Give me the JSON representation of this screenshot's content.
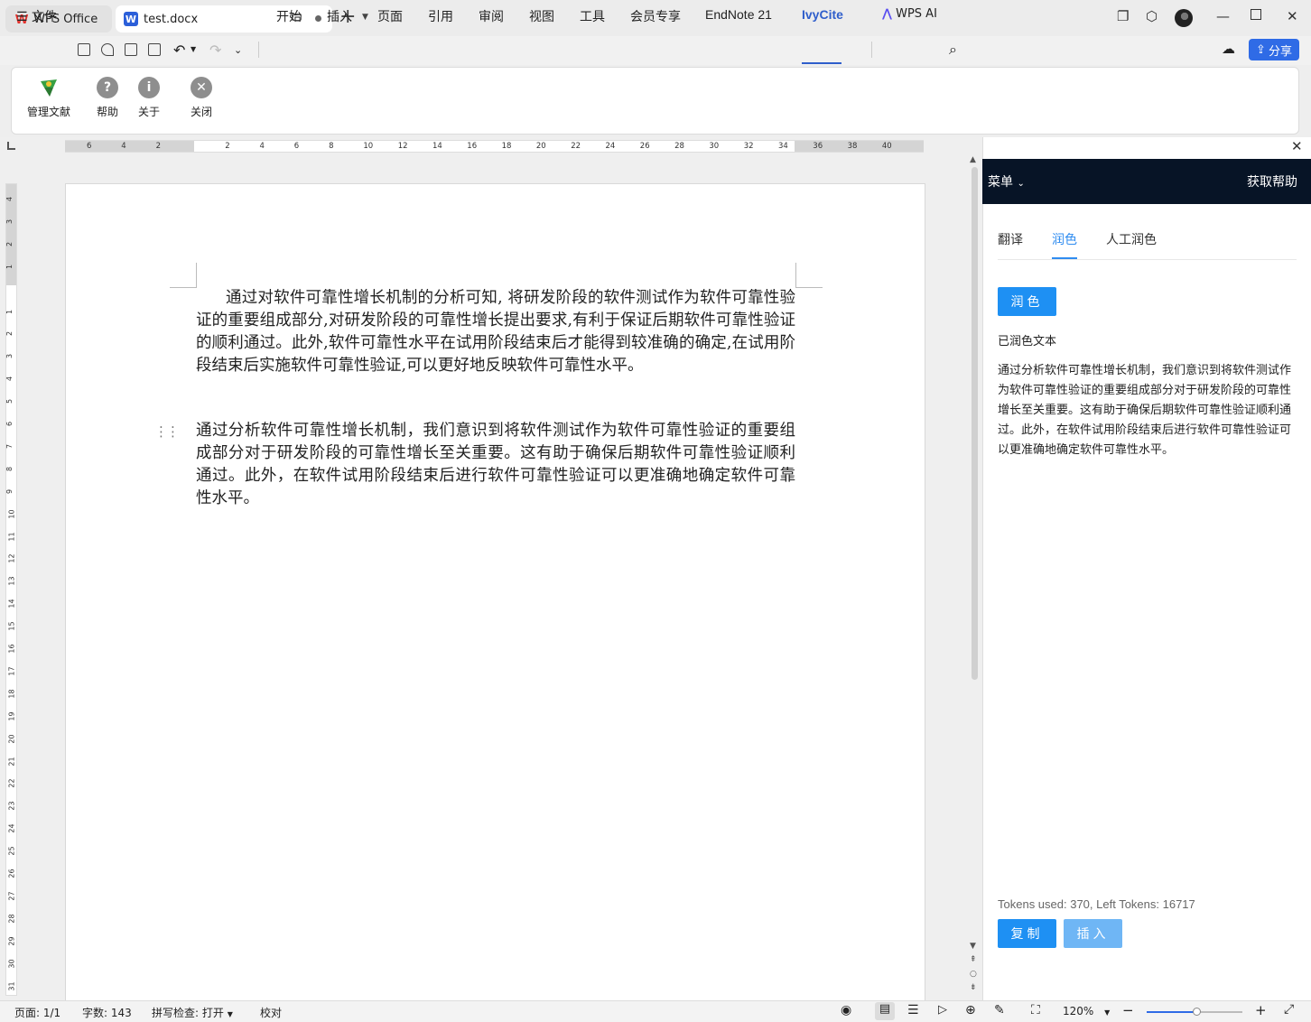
{
  "titlebar": {
    "app_tab": "WPS Office",
    "doc_tab": "test.docx"
  },
  "menubar": {
    "file": "文件",
    "items": [
      "开始",
      "插入",
      "页面",
      "引用",
      "审阅",
      "视图",
      "工具",
      "会员专享",
      "EndNote 21",
      "IvyCite"
    ],
    "active": "IvyCite",
    "wps_ai": "WPS AI",
    "share": "分享"
  },
  "ribbon": {
    "manage": "管理文献",
    "help": "帮助",
    "about": "关于",
    "close": "关闭"
  },
  "ruler": {
    "h_ticks": [
      "6",
      "4",
      "2",
      "2",
      "4",
      "6",
      "8",
      "10",
      "12",
      "14",
      "16",
      "18",
      "20",
      "22",
      "24",
      "26",
      "28",
      "30",
      "32",
      "34",
      "36",
      "38",
      "40"
    ],
    "v_ticks": [
      "4",
      "3",
      "2",
      "1",
      "1",
      "2",
      "3",
      "4",
      "5",
      "6",
      "7",
      "8",
      "9",
      "10",
      "11",
      "12",
      "13",
      "14",
      "15",
      "16",
      "17",
      "18",
      "19",
      "20",
      "21",
      "22",
      "23",
      "24",
      "25",
      "26",
      "27",
      "28",
      "29",
      "30",
      "31"
    ]
  },
  "document": {
    "para1": "通过对软件可靠性增长机制的分析可知, 将研发阶段的软件测试作为软件可靠性验证的重要组成部分,对研发阶段的可靠性增长提出要求,有利于保证后期软件可靠性验证的顺利通过。此外,软件可靠性水平在试用阶段结束后才能得到较准确的确定,在试用阶段结束后实施软件可靠性验证,可以更好地反映软件可靠性水平。",
    "para2": "通过分析软件可靠性增长机制，我们意识到将软件测试作为软件可靠性验证的重要组成部分对于研发阶段的可靠性增长至关重要。这有助于确保后期软件可靠性验证顺利通过。此外，在软件试用阶段结束后进行软件可靠性验证可以更准确地确定软件可靠性水平。"
  },
  "panel": {
    "menu": "菜单",
    "get_help": "获取帮助",
    "tabs": [
      "翻译",
      "润色",
      "人工润色"
    ],
    "active_tab": "润色",
    "polish_button": "润色",
    "polished_label": "已润色文本",
    "polished_text": "通过分析软件可靠性增长机制，我们意识到将软件测试作为软件可靠性验证的重要组成部分对于研发阶段的可靠性增长至关重要。这有助于确保后期软件可靠性验证顺利通过。此外，在软件试用阶段结束后进行软件可靠性验证可以更准确地确定软件可靠性水平。",
    "tokens": "Tokens used: 370, Left Tokens: 16717",
    "copy_button": "复制",
    "insert_button": "插入"
  },
  "statusbar": {
    "page": "页面: 1/1",
    "words": "字数: 143",
    "spell": "拼写检查: 打开",
    "proof": "校对",
    "zoom": "120%",
    "zoom_fraction": 0.52
  },
  "colors": {
    "accent": "#2f5ecb",
    "panel_header": "#071426",
    "panel_button": "#1e90f3",
    "share": "#2f6be6"
  }
}
